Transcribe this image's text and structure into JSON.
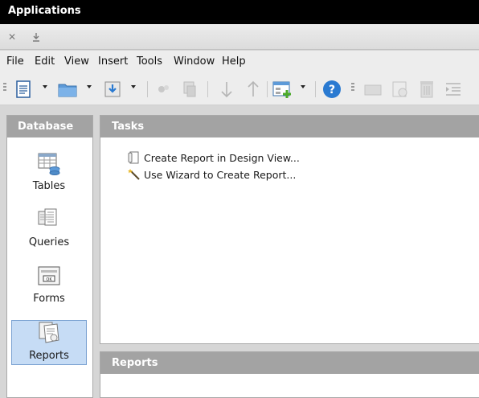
{
  "window": {
    "title": "Applications"
  },
  "tabstrip": {
    "close_icon": "close-icon",
    "download_icon": "download-icon"
  },
  "menubar": {
    "items": [
      "File",
      "Edit",
      "View",
      "Insert",
      "Tools",
      "Window",
      "Help"
    ]
  },
  "toolbar": {
    "icons": [
      "new-document-icon",
      "open-folder-icon",
      "save-icon",
      "cut-icon",
      "copy-icon",
      "sort-descending-icon",
      "sort-ascending-icon",
      "form-add-icon",
      "help-icon",
      "panel-icon",
      "report-icon",
      "delete-icon",
      "list-indent-icon"
    ]
  },
  "database": {
    "header": "Database",
    "items": [
      {
        "label": "Tables",
        "icon": "tables-icon",
        "selected": false
      },
      {
        "label": "Queries",
        "icon": "queries-icon",
        "selected": false
      },
      {
        "label": "Forms",
        "icon": "forms-icon",
        "selected": false
      },
      {
        "label": "Reports",
        "icon": "reports-icon",
        "selected": true
      }
    ]
  },
  "tasks": {
    "header": "Tasks",
    "items": [
      {
        "label": "Create Report in Design View...",
        "icon": "design-view-icon"
      },
      {
        "label": "Use Wizard to Create Report...",
        "icon": "wizard-wand-icon"
      }
    ]
  },
  "reports": {
    "header": "Reports"
  },
  "colors": {
    "titlebar": "#000000",
    "panel_header": "#a3a3a3",
    "selection": "#c6dcf5",
    "help_blue": "#2a7ad1"
  }
}
